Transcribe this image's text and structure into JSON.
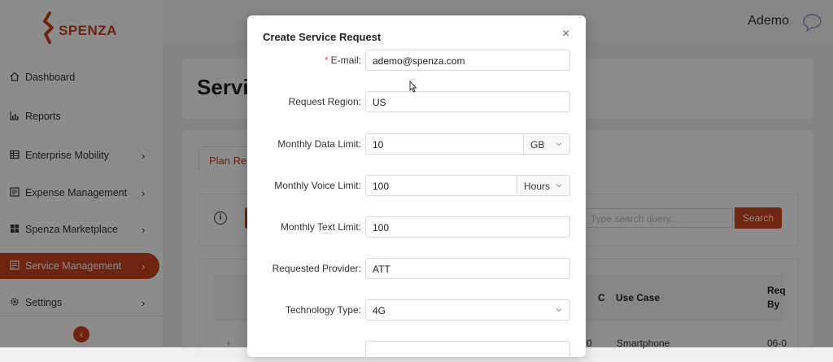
{
  "app": {
    "brand": "SPENZA",
    "brand_color": "#c8421b"
  },
  "sidebar": {
    "items": [
      {
        "label": "Dashboard",
        "icon": "home-icon",
        "arrow": ""
      },
      {
        "label": "Reports",
        "icon": "bar-chart-icon",
        "arrow": ""
      },
      {
        "label": "Enterprise Mobility",
        "icon": "table-icon",
        "arrow": "›"
      },
      {
        "label": "Expense Management",
        "icon": "ledger-icon",
        "arrow": "›"
      },
      {
        "label": "Spenza Marketplace",
        "icon": "grid-icon",
        "arrow": "›"
      },
      {
        "label": "Service Management",
        "icon": "service-icon",
        "arrow": "›",
        "active": true
      },
      {
        "label": "Settings",
        "icon": "gear-icon",
        "arrow": "›"
      }
    ],
    "collapse_glyph": "‹"
  },
  "header": {
    "user": "Ademo",
    "chat_icon": "chat-icon"
  },
  "page": {
    "title": "Servic",
    "tab": "Plan Req",
    "info_glyph": "i",
    "search_placeholder": "Type search query...",
    "search_button": "Search",
    "table": {
      "headers": [
        "Use Case",
        "Req",
        "By"
      ],
      "row": {
        "left_cell": "0",
        "use_case": "Smartphone",
        "req": "06-0",
        "marker": "+"
      },
      "partial_header_c": "C"
    }
  },
  "modal": {
    "title": "Create Service Request",
    "close_glyph": "×",
    "fields": {
      "email": {
        "label": "E-mail",
        "value": "ademo@spenza.com",
        "required": true
      },
      "region": {
        "label": "Request Region",
        "value": "US"
      },
      "data_limit": {
        "label": "Monthly Data Limit",
        "value": "10",
        "unit": "GB"
      },
      "voice_limit": {
        "label": "Monthly Voice Limit",
        "value": "100",
        "unit": "Hours"
      },
      "text_limit": {
        "label": "Monthly Text Limit",
        "value": "100"
      },
      "provider": {
        "label": "Requested Provider",
        "value": "ATT"
      },
      "technology": {
        "label": "Technology Type",
        "value": "4G"
      }
    },
    "colon": ":",
    "required_star": "*"
  }
}
